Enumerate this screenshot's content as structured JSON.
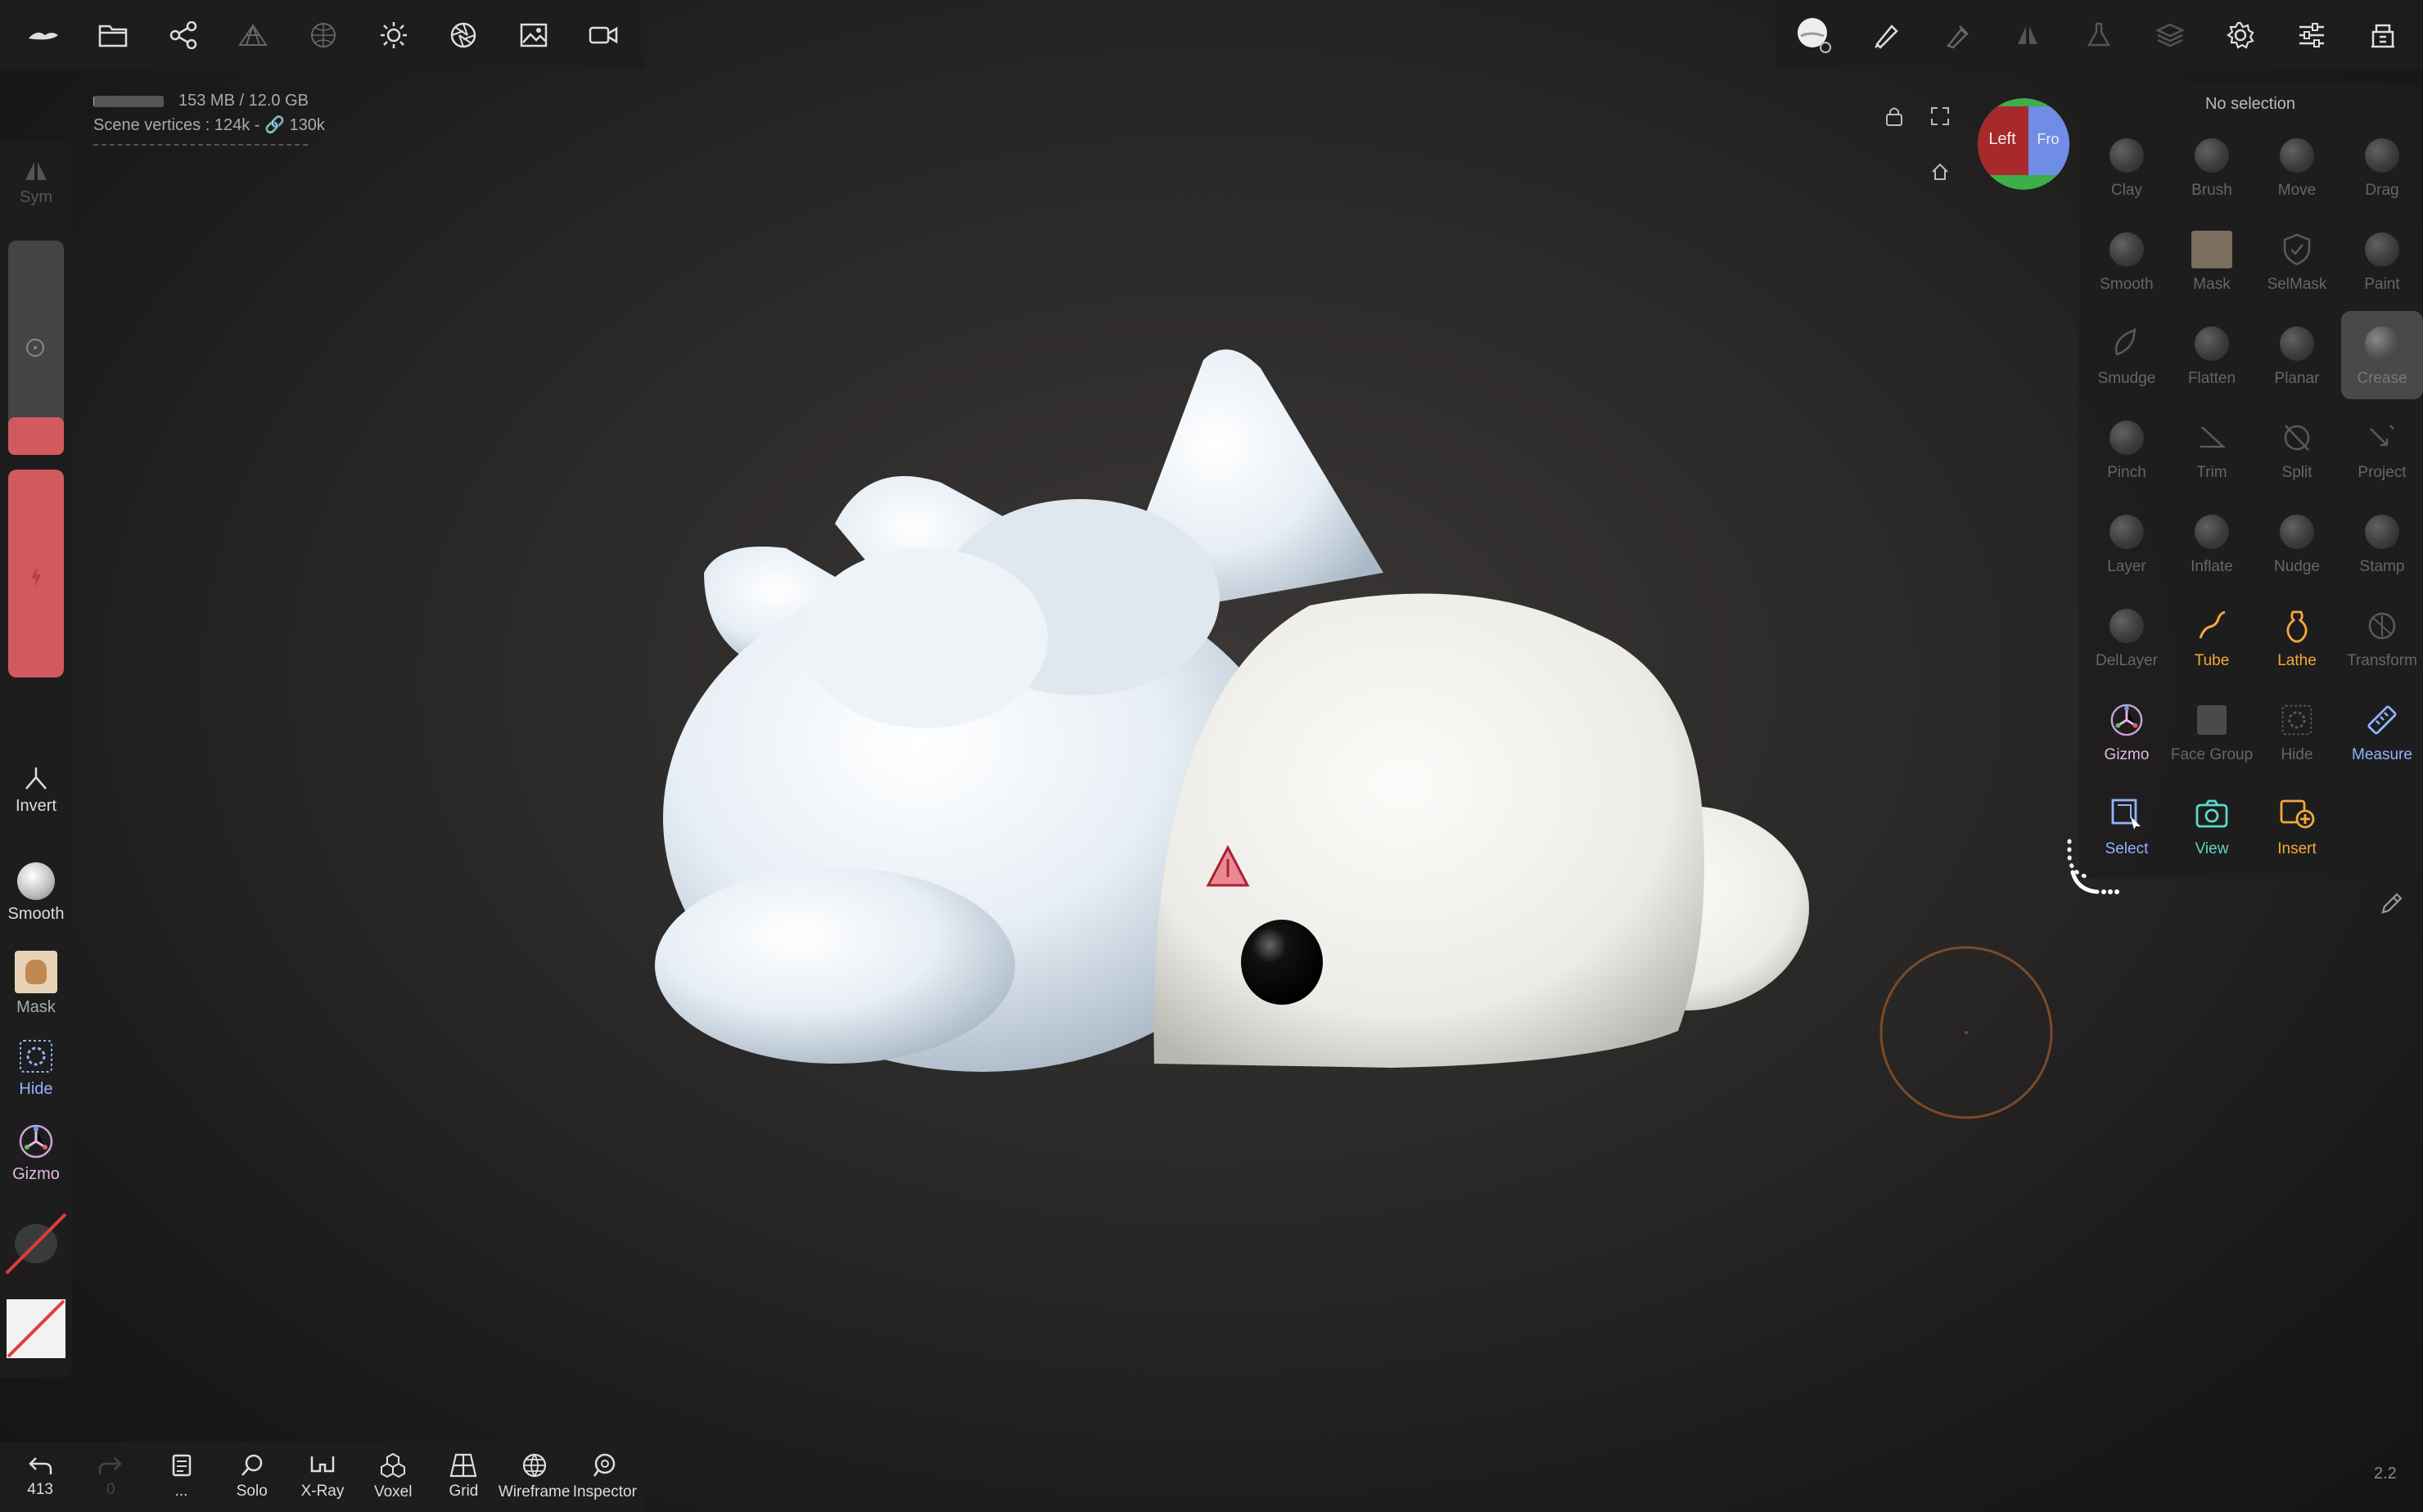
{
  "top_left_toolbar": [
    {
      "name": "app-logo-icon"
    },
    {
      "name": "folder-icon"
    },
    {
      "name": "scene-graph-icon"
    },
    {
      "name": "topology-icon"
    },
    {
      "name": "material-sphere-icon"
    },
    {
      "name": "light-icon"
    },
    {
      "name": "camera-aperture-icon"
    },
    {
      "name": "image-icon"
    },
    {
      "name": "video-camera-icon"
    }
  ],
  "top_right_toolbar": [
    {
      "name": "material-preview-icon"
    },
    {
      "name": "brush-stroke-icon",
      "sub": "..."
    },
    {
      "name": "brush-alpha-icon"
    },
    {
      "name": "symmetry-icon"
    },
    {
      "name": "flask-icon"
    },
    {
      "name": "layers-icon"
    },
    {
      "name": "settings-gear-icon"
    },
    {
      "name": "sliders-icon",
      "sub": "..."
    },
    {
      "name": "tools-grid-icon"
    }
  ],
  "info": {
    "memory": "153 MB / 12.0 GB",
    "memory_used_fraction": 0.0125,
    "vertices": "Scene vertices :  124k - 🔗 130k"
  },
  "left_bar": {
    "sym_label": "Sym",
    "radius_level": 0.0,
    "intensity_level": 1.0,
    "invert_label": "Invert",
    "smooth_label": "Smooth",
    "mask_label": "Mask",
    "hide_label": "Hide",
    "gizmo_label": "Gizmo"
  },
  "bottom_bar": {
    "undo_count": "413",
    "redo_count": "0",
    "more_label": "...",
    "solo": "Solo",
    "xray": "X-Ray",
    "voxel": "Voxel",
    "grid": "Grid",
    "wireframe": "Wireframe",
    "inspector": "Inspector"
  },
  "tools_panel": {
    "title": "No selection",
    "tools": [
      {
        "label": "Clay",
        "state": "disabled",
        "icon": "sphere"
      },
      {
        "label": "Brush",
        "state": "disabled",
        "icon": "sphere"
      },
      {
        "label": "Move",
        "state": "disabled",
        "icon": "sphere"
      },
      {
        "label": "Drag",
        "state": "disabled",
        "icon": "sphere"
      },
      {
        "label": "Smooth",
        "state": "disabled",
        "icon": "sphere"
      },
      {
        "label": "Mask",
        "state": "disabled",
        "icon": "mask"
      },
      {
        "label": "SelMask",
        "state": "disabled",
        "icon": "shield"
      },
      {
        "label": "Paint",
        "state": "disabled",
        "icon": "sphere"
      },
      {
        "label": "Smudge",
        "state": "disabled",
        "icon": "smudge"
      },
      {
        "label": "Flatten",
        "state": "disabled",
        "icon": "sphere"
      },
      {
        "label": "Planar",
        "state": "disabled",
        "icon": "sphere"
      },
      {
        "label": "Crease",
        "state": "selected",
        "icon": "sphere"
      },
      {
        "label": "Pinch",
        "state": "disabled",
        "icon": "sphere"
      },
      {
        "label": "Trim",
        "state": "disabled",
        "icon": "trim"
      },
      {
        "label": "Split",
        "state": "disabled",
        "icon": "split"
      },
      {
        "label": "Project",
        "state": "disabled",
        "icon": "project"
      },
      {
        "label": "Layer",
        "state": "disabled",
        "icon": "sphere"
      },
      {
        "label": "Inflate",
        "state": "disabled",
        "icon": "sphere"
      },
      {
        "label": "Nudge",
        "state": "disabled",
        "icon": "sphere"
      },
      {
        "label": "Stamp",
        "state": "disabled",
        "icon": "sphere"
      },
      {
        "label": "DelLayer",
        "state": "disabled",
        "icon": "sphere"
      },
      {
        "label": "Tube",
        "state": "active",
        "color": "#f2a93b",
        "icon": "tube"
      },
      {
        "label": "Lathe",
        "state": "active",
        "color": "#f2a93b",
        "icon": "lathe"
      },
      {
        "label": "Transform",
        "state": "disabled",
        "icon": "transform"
      },
      {
        "label": "Gizmo",
        "state": "active",
        "color": "#e4b8e8",
        "icon": "gizmo"
      },
      {
        "label": "Face Group",
        "state": "disabled",
        "icon": "facegroup"
      },
      {
        "label": "Hide",
        "state": "disabled",
        "icon": "hide"
      },
      {
        "label": "Measure",
        "state": "active",
        "color": "#8fb3ff",
        "icon": "measure"
      },
      {
        "label": "Select",
        "state": "active",
        "color": "#8fb3ff",
        "icon": "select"
      },
      {
        "label": "View",
        "state": "active",
        "color": "#5fd6c8",
        "icon": "view"
      },
      {
        "label": "Insert",
        "state": "active",
        "color": "#f2a93b",
        "icon": "insert"
      }
    ]
  },
  "view_gizmo": {
    "left": "Left",
    "front": "Fro"
  },
  "version": "2.2",
  "colors": {
    "accent_red": "#d25a5f",
    "panel": "#1e1d1d",
    "orange": "#f2a93b",
    "blue": "#8fb3ff",
    "teal": "#5fd6c8"
  }
}
